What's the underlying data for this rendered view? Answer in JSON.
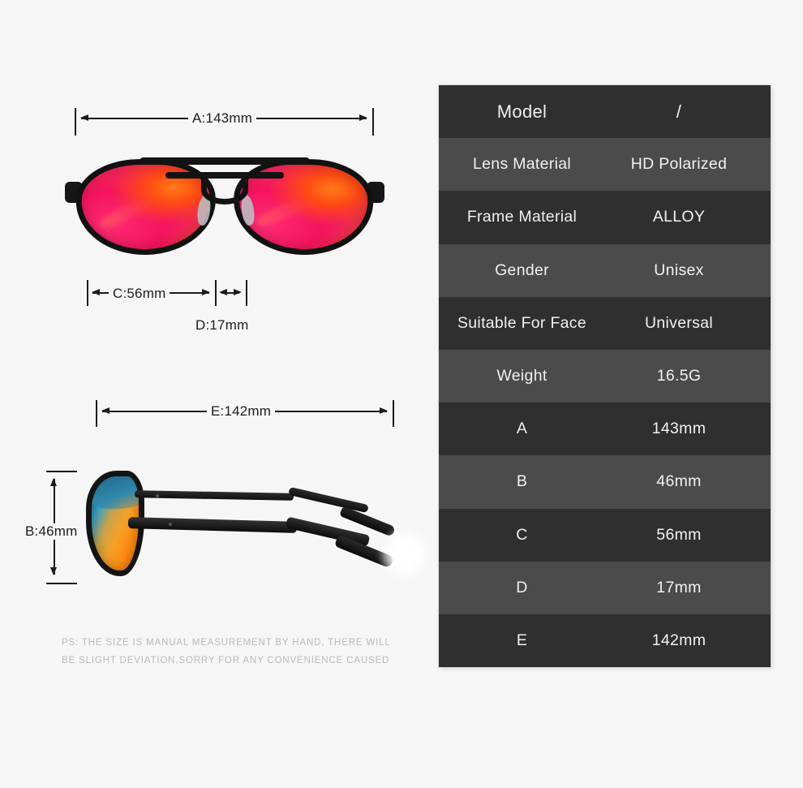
{
  "page": {
    "background_color": "#f6f6f6",
    "disclaimer_line_1": "PS: THE SIZE IS MANUAL MEASUREMENT BY HAND, THERE WILL",
    "disclaimer_line_2": "BE SLIGHT DEVIATION,SORRY FOR ANY CONVENIENCE CAUSED"
  },
  "dimensions": {
    "a_label": "A:143mm",
    "b_label": "B:46mm",
    "c_label": "C:56mm",
    "d_label": "D:17mm",
    "e_label": "E:142mm"
  },
  "product": {
    "front_view_name": "sunglasses-front-view",
    "side_view_name": "sunglasses-side-view",
    "frame_color": "#131313",
    "lens_front_color": "#f31f62",
    "lens_side_color": "#f4a12a"
  },
  "spec_table": {
    "row_color_odd": "#2f2f2f",
    "row_color_even": "#4b4b4b",
    "text_color": "#f0f0f0",
    "rows": [
      {
        "label": "Model",
        "value": "/"
      },
      {
        "label": "Lens Material",
        "value": "HD Polarized"
      },
      {
        "label": "Frame Material",
        "value": "ALLOY"
      },
      {
        "label": "Gender",
        "value": "Unisex"
      },
      {
        "label": "Suitable For Face",
        "value": "Universal"
      },
      {
        "label": "Weight",
        "value": "16.5G"
      },
      {
        "label": "A",
        "value": "143mm"
      },
      {
        "label": "B",
        "value": "46mm"
      },
      {
        "label": "C",
        "value": "56mm"
      },
      {
        "label": "D",
        "value": "17mm"
      },
      {
        "label": "E",
        "value": "142mm"
      }
    ]
  }
}
